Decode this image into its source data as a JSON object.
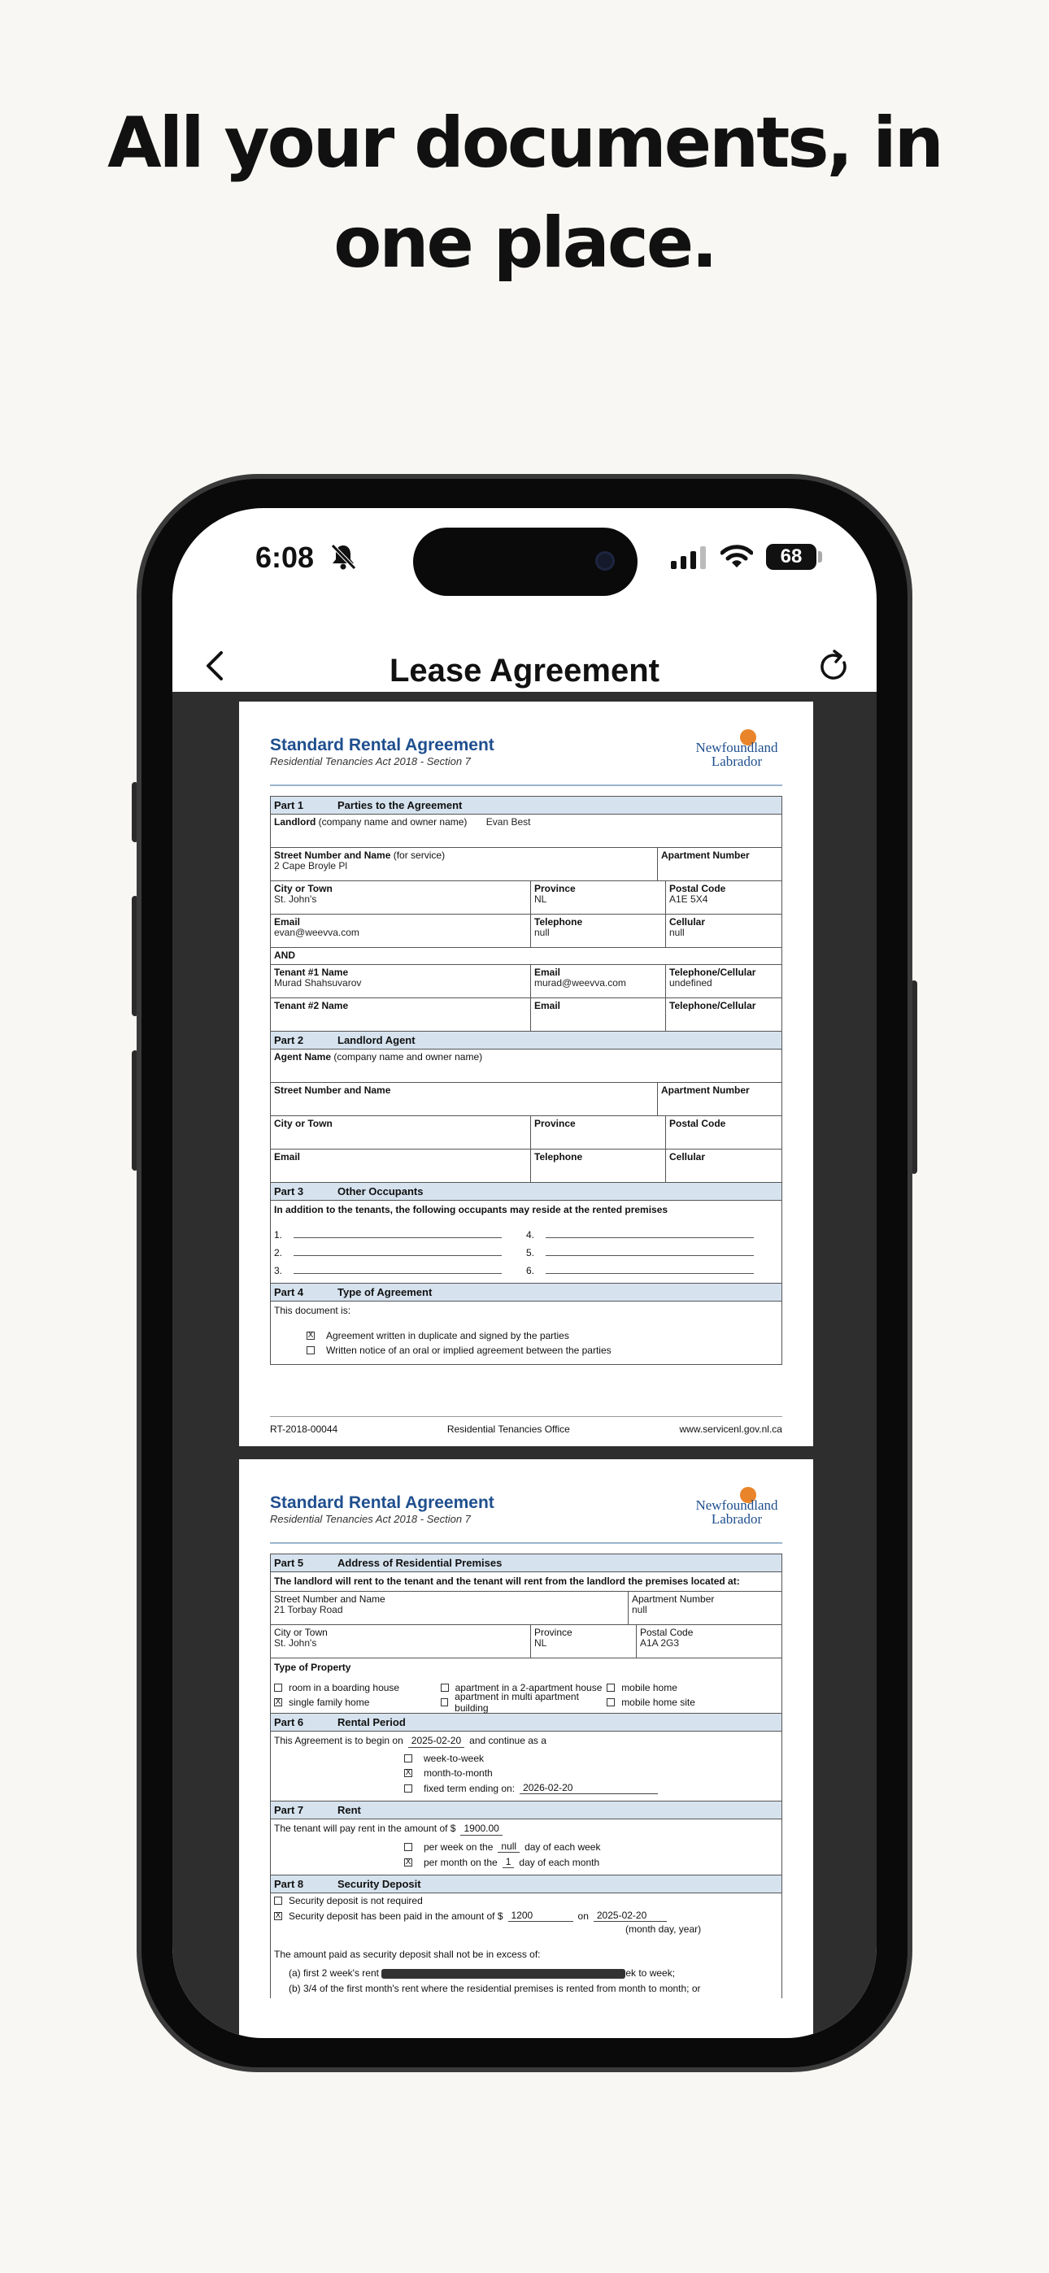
{
  "headline": "All your documents, in one place.",
  "status_bar": {
    "time": "6:08",
    "battery": "68"
  },
  "navbar": {
    "title": "Lease Agreement"
  },
  "doc": {
    "title": "Standard Rental Agreement",
    "subtitle": "Residential Tenancies Act 2018 - Section 7",
    "logo_line1": "Newfoundland",
    "logo_line2": "Labrador",
    "footer_left": "RT-2018-00044",
    "footer_mid": "Residential Tenancies Office",
    "footer_right": "www.servicenl.gov.nl.ca"
  },
  "part1": {
    "num": "Part 1",
    "title": "Parties to the Agreement",
    "landlord_label": "Landlord",
    "landlord_hint": "(company name and owner name)",
    "landlord_value": "Evan Best",
    "street_label": "Street Number and Name",
    "street_hint": "(for service)",
    "street_value": "2 Cape Broyle Pl",
    "apt_label": "Apartment Number",
    "city_label": "City or Town",
    "city_value": "St. John's",
    "province_label": "Province",
    "province_value": "NL",
    "postal_label": "Postal Code",
    "postal_value": "A1E 5X4",
    "email_label": "Email",
    "email_value": "evan@weevva.com",
    "tel_label": "Telephone",
    "tel_value": "null",
    "cell_label": "Cellular",
    "cell_value": "null",
    "and_label": "AND",
    "t1_label": "Tenant #1 Name",
    "t1_value": "Murad Shahsuvarov",
    "t1_email_label": "Email",
    "t1_email_value": "murad@weevva.com",
    "t1_tel_label": "Telephone/Cellular",
    "t1_tel_value": "undefined",
    "t2_label": "Tenant #2 Name",
    "t2_email_label": "Email",
    "t2_tel_label": "Telephone/Cellular"
  },
  "part2": {
    "num": "Part 2",
    "title": "Landlord Agent",
    "agent_label": "Agent Name",
    "agent_hint": "(company name and owner name)",
    "street_label": "Street Number and Name",
    "apt_label": "Apartment Number",
    "city_label": "City or Town",
    "province_label": "Province",
    "postal_label": "Postal Code",
    "email_label": "Email",
    "tel_label": "Telephone",
    "cell_label": "Cellular"
  },
  "part3": {
    "num": "Part 3",
    "title": "Other Occupants",
    "intro": "In addition to the tenants, the following occupants may reside at the rented premises",
    "n1": "1.",
    "n2": "2.",
    "n3": "3.",
    "n4": "4.",
    "n5": "5.",
    "n6": "6."
  },
  "part4": {
    "num": "Part 4",
    "title": "Type of Agreement",
    "intro": "This document is:",
    "opt1": "Agreement written in duplicate and signed by the parties",
    "opt2": "Written notice of an oral or implied agreement between the parties",
    "opt1_mark": "X",
    "opt2_mark": ""
  },
  "part5": {
    "num": "Part 5",
    "title": "Address of Residential Premises",
    "intro": "The landlord will rent to the tenant and the tenant will rent from the landlord the premises located at:",
    "street_label": "Street Number and Name",
    "street_value": "21 Torbay Road",
    "apt_label": "Apartment Number",
    "apt_value": "null",
    "city_label": "City or Town",
    "city_value": "St. John's",
    "province_label": "Province",
    "province_value": "NL",
    "postal_label": "Postal Code",
    "postal_value": "A1A 2G3",
    "type_label": "Type of Property",
    "types": [
      {
        "label": "room in a boarding house",
        "mark": ""
      },
      {
        "label": "apartment in a 2-apartment house",
        "mark": ""
      },
      {
        "label": "mobile home",
        "mark": ""
      },
      {
        "label": "single family home",
        "mark": "X"
      },
      {
        "label": "apartment in multi apartment building",
        "mark": ""
      },
      {
        "label": "mobile home site",
        "mark": ""
      }
    ]
  },
  "part6": {
    "num": "Part 6",
    "title": "Rental Period",
    "begin_text": "This Agreement is to begin on",
    "begin_value": "2025-02-20",
    "continue_text": "and continue as a",
    "opts": [
      {
        "label": "week-to-week",
        "mark": ""
      },
      {
        "label": "month-to-month",
        "mark": "X"
      },
      {
        "label": "fixed term ending on:",
        "mark": "",
        "value": "2026-02-20"
      }
    ]
  },
  "part7": {
    "num": "Part 7",
    "title": "Rent",
    "text": "The tenant will pay rent in the amount of $",
    "amount": "1900.00",
    "week_a": "per week on the",
    "week_val": "null",
    "week_b": "day of each week",
    "month_a": "per month on the",
    "month_val": "1",
    "month_b": "day of each month",
    "week_mark": "",
    "month_mark": "X"
  },
  "part8": {
    "num": "Part 8",
    "title": "Security Deposit",
    "opt1": "Security deposit is not required",
    "opt1_mark": "",
    "opt2": "Security deposit has been paid in the amount of $",
    "opt2_mark": "X",
    "amount": "1200",
    "on_label": "on",
    "date_value": "2025-02-20",
    "date_hint": "(month day, year)",
    "limit_text": "The amount paid as security deposit shall not be in excess of:",
    "item_a_start": "(a)  first 2 week's rent",
    "item_a_end": "ek to week;",
    "item_b": "(b)  3/4 of the first month's rent where the residential premises is rented from month to month; or"
  }
}
